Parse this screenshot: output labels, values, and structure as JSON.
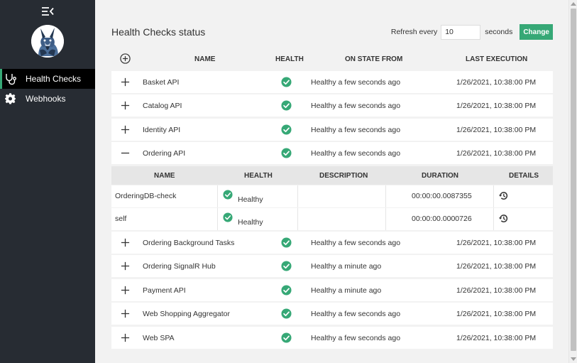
{
  "theme": {
    "accent": "#36a876",
    "sidebar_bg": "#272c33",
    "active_bg": "#000000"
  },
  "sidebar": {
    "toggle_icon": "menu-collapse-icon",
    "logo": "husky-dog-logo",
    "items": [
      {
        "label": "Health Checks",
        "icon": "stethoscope-icon",
        "active": true
      },
      {
        "label": "Webhooks",
        "icon": "gear-icon",
        "active": false
      }
    ]
  },
  "main": {
    "title": "Health Checks status",
    "refresh": {
      "label_before": "Refresh every",
      "value": "10",
      "label_after": "seconds",
      "button": "Change"
    },
    "columns": {
      "name": "NAME",
      "health": "HEALTH",
      "on_state_from": "ON STATE FROM",
      "last_execution": "LAST EXECUTION"
    },
    "rows": [
      {
        "name": "Basket API",
        "health": "Healthy",
        "state": "Healthy a few seconds ago",
        "exec": "1/26/2021, 10:38:00 PM",
        "expanded": false
      },
      {
        "name": "Catalog API",
        "health": "Healthy",
        "state": "Healthy a few seconds ago",
        "exec": "1/26/2021, 10:38:00 PM",
        "expanded": false
      },
      {
        "name": "Identity API",
        "health": "Healthy",
        "state": "Healthy a few seconds ago",
        "exec": "1/26/2021, 10:38:00 PM",
        "expanded": false
      },
      {
        "name": "Ordering API",
        "health": "Healthy",
        "state": "Healthy a few seconds ago",
        "exec": "1/26/2021, 10:38:00 PM",
        "expanded": true
      },
      {
        "name": "Ordering Background Tasks",
        "health": "Healthy",
        "state": "Healthy a few seconds ago",
        "exec": "1/26/2021, 10:38:00 PM",
        "expanded": false
      },
      {
        "name": "Ordering SignalR Hub",
        "health": "Healthy",
        "state": "Healthy a minute ago",
        "exec": "1/26/2021, 10:38:00 PM",
        "expanded": false
      },
      {
        "name": "Payment API",
        "health": "Healthy",
        "state": "Healthy a minute ago",
        "exec": "1/26/2021, 10:38:00 PM",
        "expanded": false
      },
      {
        "name": "Web Shopping Aggregator",
        "health": "Healthy",
        "state": "Healthy a few seconds ago",
        "exec": "1/26/2021, 10:38:00 PM",
        "expanded": false
      },
      {
        "name": "Web SPA",
        "health": "Healthy",
        "state": "Healthy a few seconds ago",
        "exec": "1/26/2021, 10:38:00 PM",
        "expanded": false
      }
    ],
    "details": {
      "columns": {
        "name": "NAME",
        "health": "HEALTH",
        "description": "DESCRIPTION",
        "duration": "DURATION",
        "details": "DETAILS"
      },
      "rows": [
        {
          "name": "OrderingDB-check",
          "health": "Healthy",
          "description": "",
          "duration": "00:00:00.0087355"
        },
        {
          "name": "self",
          "health": "Healthy",
          "description": "",
          "duration": "00:00:00.0000726"
        }
      ]
    }
  }
}
